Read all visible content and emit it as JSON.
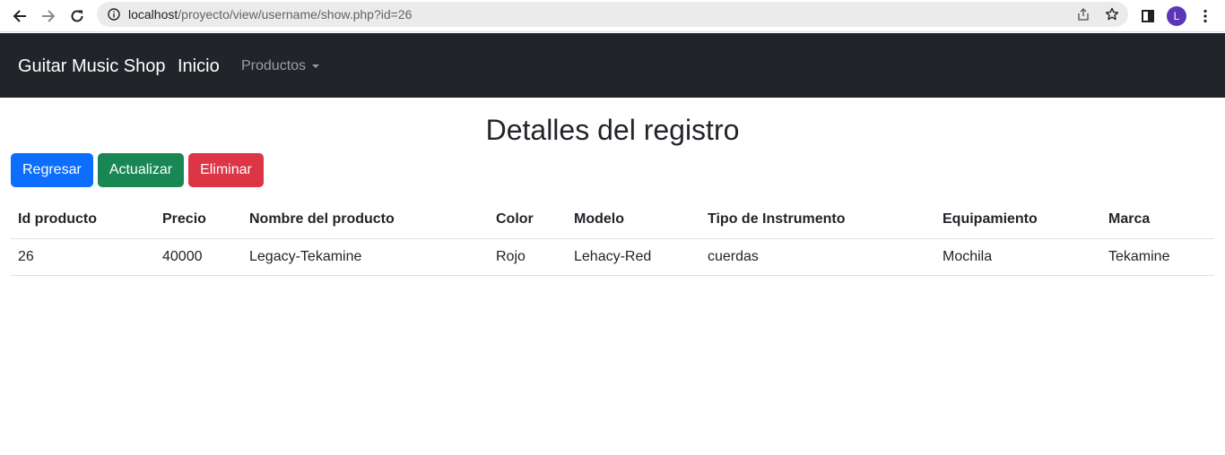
{
  "browser": {
    "url_host": "localhost",
    "url_path": "/proyecto/view/username/show.php?id=26",
    "profile_initial": "L",
    "colors": {
      "avatar": "#5c35b8",
      "omnibox": "#ebebeb"
    }
  },
  "navbar": {
    "brand": "Guitar Music Shop",
    "home": "Inicio",
    "products_dropdown": "Productos",
    "colors": {
      "background": "#212529"
    }
  },
  "main": {
    "title": "Detalles del registro",
    "buttons": {
      "back": "Regresar",
      "update": "Actualizar",
      "delete": "Eliminar"
    },
    "colors": {
      "primary": "#0d6efd",
      "success": "#198754",
      "danger": "#dc3545"
    },
    "table": {
      "headers": [
        "Id producto",
        "Precio",
        "Nombre del producto",
        "Color",
        "Modelo",
        "Tipo de Instrumento",
        "Equipamiento",
        "Marca"
      ],
      "rows": [
        [
          "26",
          "40000",
          "Legacy-Tekamine",
          "Rojo",
          "Lehacy-Red",
          "cuerdas",
          "Mochila",
          "Tekamine"
        ]
      ]
    }
  }
}
